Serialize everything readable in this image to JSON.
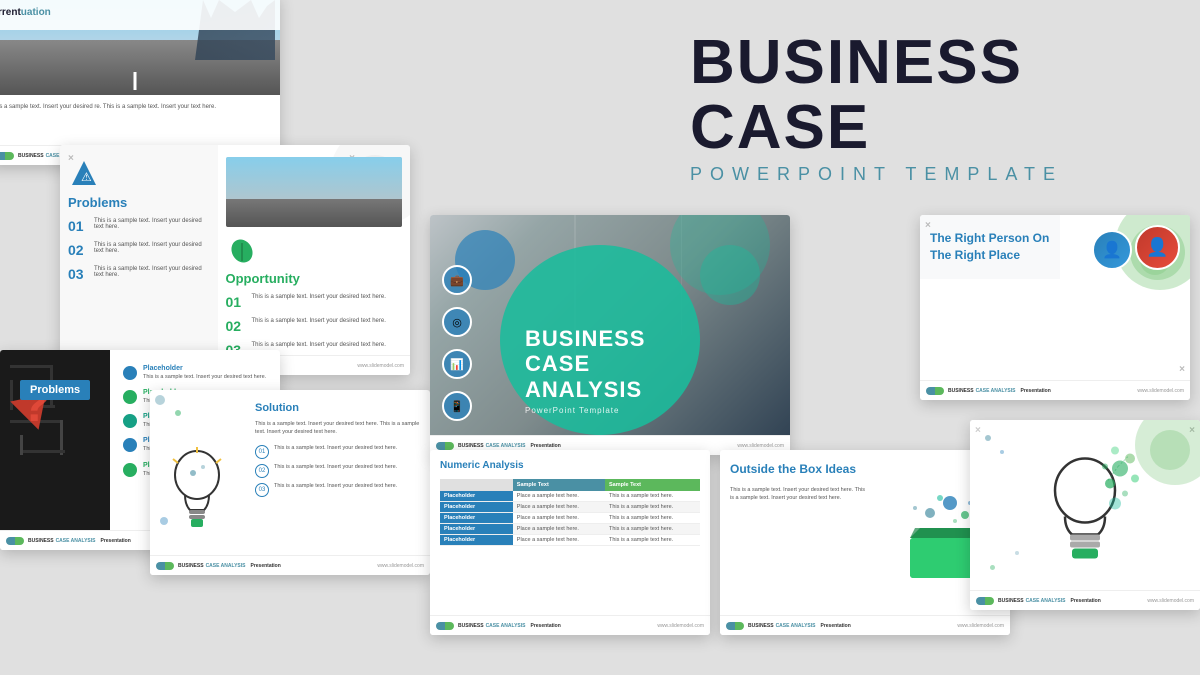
{
  "page": {
    "background": "#e0e0e0",
    "title": "BUSINESS CASE",
    "subtitle": "POWERPOINT TEMPLATE"
  },
  "slides": {
    "top_left": {
      "header_title": "rrent",
      "header_subtitle": "uation",
      "body_text": "is a sample text. Insert your desired\nre. This is a sample text. Insert your\n text here."
    },
    "mid_left": {
      "footer_label": "BUSINESS CASE ANALYSIS",
      "footer_type": "Presentation",
      "footer_url": "www.slidemodel.com",
      "problems_title": "Problems",
      "opportunity_title": "Opportunity",
      "row1_num": "01",
      "row2_num": "02",
      "row3_num": "03",
      "sample_text": "This is a sample text. Insert your desired text here.",
      "sample_text2": "This is a sample text. Insert your desired text here.",
      "sample_text3": "This is a sample text. Insert your desired text here."
    },
    "bot_left": {
      "title": "Problems",
      "placeholder1": "Placeholder",
      "placeholder2": "Placeholder",
      "placeholder3": "Placeholder",
      "placeholder4": "Placeholder",
      "placeholder5": "Placeholder",
      "text1": "This is a sample text. Insert your desired text here.",
      "footer_label": "BUSINESS CASE ANALYSIS",
      "footer_url": "www.slidemodel.com"
    },
    "bot_center_left": {
      "title": "Solution",
      "body_text": "This is a sample text. Insert your desired text here. This is a sample text. Insert your desired text here.",
      "row1": "01",
      "row2": "02",
      "row3": "03",
      "footer_label": "BUSINESS CASE ANALYSIS",
      "footer_url": "www.slidemodel.com"
    },
    "center_main": {
      "title": "BUSINESS CASE ANALYSIS",
      "subtitle": "PowerPoint Template",
      "footer_label": "BUSINESS CASE ANALYSIS",
      "footer_url": "www.slidemodel.com"
    },
    "bot_center": {
      "title": "Numeric Analysis",
      "col1": "Sample Text",
      "col2": "Sample Text",
      "placeholder": "Placeholder",
      "footer_label": "BUSINESS CASE ANALYSIS",
      "footer_url": "www.slidemodel.com"
    },
    "bot_right": {
      "title": "Outside the Box Ideas",
      "subtitle_line1": "Outside the",
      "body_text": "This is a sample text. Insert your desired text here. This is a sample text. Insert your desired text here.",
      "footer_label": "BUSINESS CASE ANALYSIS",
      "footer_url": "www.slidemodel.com"
    },
    "top_right": {
      "title": "The Right Person On The Right Place",
      "footer_label": "BUSINESS CASE ANALYSIS",
      "footer_url": "www.slidemodel.com"
    },
    "far_right": {
      "footer_label": "BUSINESS CASE ANALYSIS",
      "footer_url": "www.slidemodel.com"
    }
  },
  "colors": {
    "blue": "#2980b9",
    "teal": "#1abc9c",
    "green": "#27ae60",
    "dark": "#1a1a2e",
    "accent_teal": "#4a90a4",
    "red": "#e74c3c"
  },
  "icons": {
    "toggle": "⊙",
    "briefcase": "💼",
    "target": "◎",
    "chart": "📊",
    "phone": "📱",
    "lightbulb": "💡",
    "box": "📦",
    "warning": "⚠",
    "leaf": "🌱",
    "question": "?"
  }
}
